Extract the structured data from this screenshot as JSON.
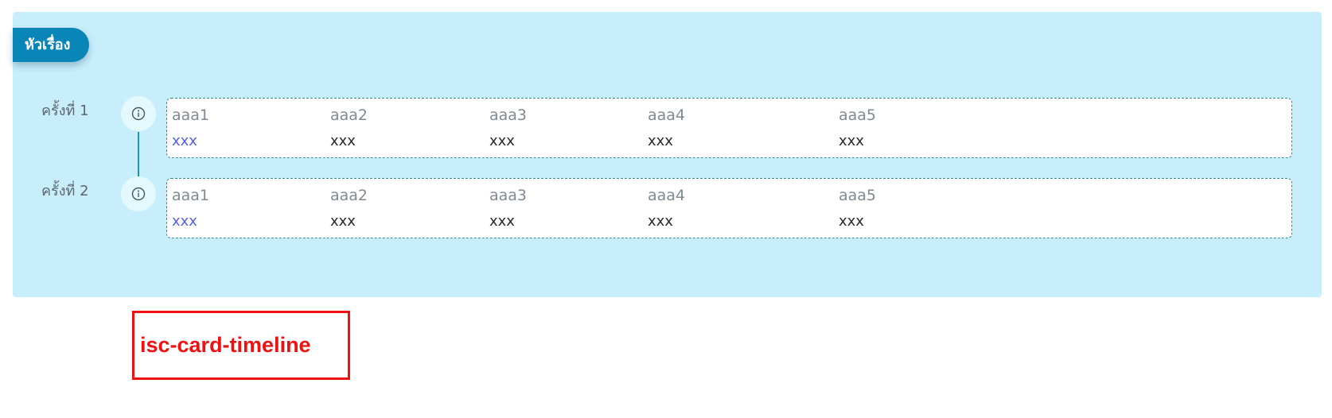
{
  "card": {
    "title": "หัวเรื่อง",
    "rounds": [
      {
        "label": "ครั้งที่ 1",
        "fields": [
          {
            "label": "aaa1",
            "value": "xxx"
          },
          {
            "label": "aaa2",
            "value": "xxx"
          },
          {
            "label": "aaa3",
            "value": "xxx"
          },
          {
            "label": "aaa4",
            "value": "xxx"
          },
          {
            "label": "aaa5",
            "value": "xxx"
          }
        ]
      },
      {
        "label": "ครั้งที่ 2",
        "fields": [
          {
            "label": "aaa1",
            "value": "xxx"
          },
          {
            "label": "aaa2",
            "value": "xxx"
          },
          {
            "label": "aaa3",
            "value": "xxx"
          },
          {
            "label": "aaa4",
            "value": "xxx"
          },
          {
            "label": "aaa5",
            "value": "xxx"
          }
        ]
      }
    ]
  },
  "caption": "isc-card-timeline",
  "icons": {
    "round_marker": "info-circle-icon"
  },
  "colors": {
    "card_background": "#c8eefc",
    "title_pill": "#0a85b8",
    "timeline": "#1a9aa6",
    "link": "#5560e0",
    "caption": "#ee1111"
  }
}
